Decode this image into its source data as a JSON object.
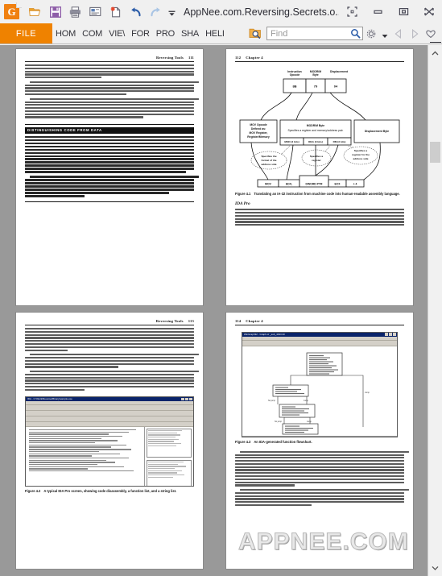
{
  "window": {
    "app_icon": "pdf-app-icon",
    "app_icon_letter": "G",
    "document_title": "AppNee.com.Reversing.Secrets.o...",
    "toolbar_buttons": [
      {
        "name": "open-file-button",
        "icon": "folder-open-icon",
        "label": "Open"
      },
      {
        "name": "save-button",
        "icon": "floppy-disk-icon",
        "label": "Save"
      },
      {
        "name": "print-button",
        "icon": "printer-icon",
        "label": "Print"
      },
      {
        "name": "email-button",
        "icon": "envelope-icon",
        "label": "Email"
      },
      {
        "name": "new-from-scanner-button",
        "icon": "new-page-star-icon",
        "label": "Create"
      },
      {
        "name": "undo-button",
        "icon": "undo-arrow-icon",
        "label": "Undo"
      },
      {
        "name": "redo-button",
        "icon": "redo-arrow-icon",
        "label": "Redo"
      },
      {
        "name": "customize-quick-access-button",
        "icon": "chevron-down-icon",
        "label": ""
      }
    ],
    "controls": [
      {
        "name": "fullscreen-button",
        "icon": "expand-corners-icon"
      },
      {
        "name": "minimize-button",
        "icon": "minimize-icon"
      },
      {
        "name": "maximize-button",
        "icon": "restore-icon"
      },
      {
        "name": "close-button",
        "icon": "close-icon"
      }
    ]
  },
  "ribbon": {
    "file_tab": "FILE",
    "tabs": [
      {
        "label": "HOM",
        "name": "tab-home"
      },
      {
        "label": "COM",
        "name": "tab-comment"
      },
      {
        "label": "VIE\\",
        "name": "tab-view"
      },
      {
        "label": "FOR",
        "name": "tab-form"
      },
      {
        "label": "PRO",
        "name": "tab-protect"
      },
      {
        "label": "SHA",
        "name": "tab-share"
      },
      {
        "label": "HELI",
        "name": "tab-help"
      }
    ],
    "search_doc_icon": "search-document-icon",
    "find": {
      "placeholder": "Find",
      "value": "",
      "icon": "magnifier-icon"
    },
    "settings_icon": "gear-icon",
    "settings_caret": "▾",
    "prev_icon": "prev-triangle-icon",
    "next_icon": "next-triangle-icon",
    "favorite_icon": "heart-icon"
  },
  "document": {
    "watermark": "APPNEE.COM",
    "pages": [
      {
        "name": "page-111",
        "number": "111",
        "running_head": "Reversing Tools",
        "head_align": "right",
        "sidebar": {
          "title": "DISTINGUISHING CODE FROM DATA"
        }
      },
      {
        "name": "page-112",
        "number": "112",
        "running_head": "Chapter 4",
        "head_align": "left",
        "figure": {
          "caption_num": "Figure 4.1",
          "caption_text": "Translating an IA-32 instruction from machine code into human-readable assembly language.",
          "top_labels": [
            "Instruction Opcode",
            "MODR/M Byte",
            "Displacement"
          ],
          "top_bytes": [
            "8B",
            "79",
            "04"
          ],
          "mid_boxes": [
            "MOV Opcode Defined as: MOV Register, Register/Memory",
            "MODR/M Byte Specifies a register and memory/address pair.",
            "Displacement Byte"
          ],
          "modrm_fields": [
            "MOD (2 bits)",
            "REG (3 bits)",
            "RM (3 bits)"
          ],
          "bubbles": [
            "Specifies the format of the address side",
            "Specifies a register",
            "Specifies a register for the address side"
          ],
          "asm_tokens": [
            "MOV",
            "EDX,",
            "DWORD PTR",
            "ECX",
            "+ 4"
          ]
        },
        "section": {
          "title": "IDA Pro"
        }
      },
      {
        "name": "page-113",
        "number": "113",
        "running_head": "Reversing Tools",
        "head_align": "right",
        "figure": {
          "caption_num": "Figure 4.2",
          "caption_text": "A typical IDA Pro screen, showing code disassembly, a function list, and a string list.",
          "screenshot_title": "IDA - C:\\Work\\Reverse\\Binary\\sample.exe"
        }
      },
      {
        "name": "page-114",
        "number": "114",
        "running_head": "Chapter 4",
        "head_align": "left",
        "figure": {
          "caption_num": "Figure 4.3",
          "caption_text": "An IDA-generated function flowchart.",
          "screenshot_title": "WinGraph32 - Graph of _sub_401C10"
        }
      }
    ]
  },
  "scrollbar": {
    "up_arrow_icon": "chevron-up-icon",
    "down_arrow_icon": "chevron-down-icon",
    "thumb_name": "vertical-scroll-thumb"
  },
  "colors": {
    "accent": "#ef8200",
    "titlebar": "#f0f0f0",
    "viewport": "#999999",
    "page": "#ffffff"
  }
}
